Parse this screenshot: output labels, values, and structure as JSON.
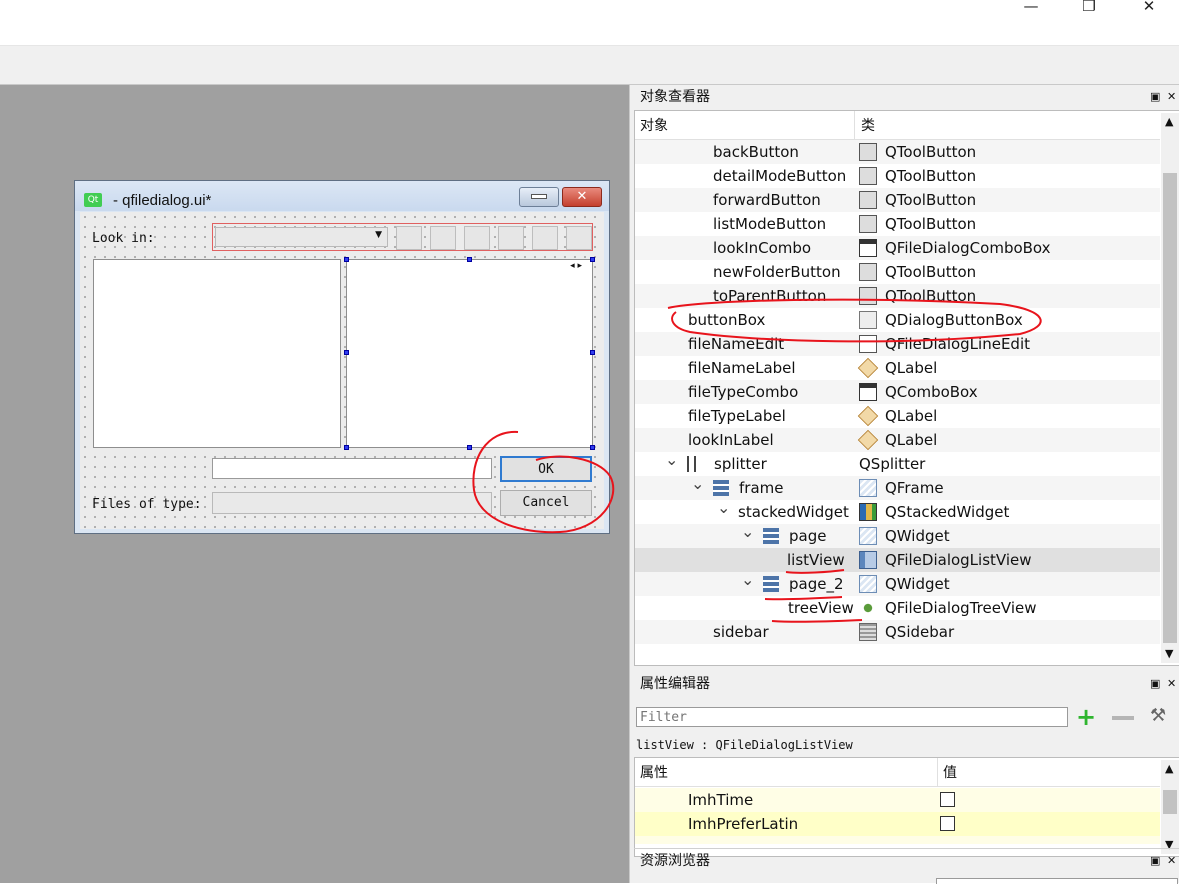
{
  "window": {
    "minimize": "—",
    "maximize": "❐",
    "close": "✕"
  },
  "form": {
    "title": "- qfiledialog.ui*",
    "logo": "Qt",
    "look_in_label": "Look in:",
    "files_of_type_label": "Files of type:",
    "ok_label": "OK",
    "cancel_label": "Cancel",
    "nav_arrows": "◂ ▸"
  },
  "object_inspector": {
    "title": "对象查看器",
    "col_object": "对象",
    "col_class": "类",
    "rows": [
      {
        "name": "backButton",
        "cls": "QToolButton",
        "icon": "tool-button-icon"
      },
      {
        "name": "detailModeButton",
        "cls": "QToolButton",
        "icon": "tool-button-icon"
      },
      {
        "name": "forwardButton",
        "cls": "QToolButton",
        "icon": "tool-button-icon"
      },
      {
        "name": "listModeButton",
        "cls": "QToolButton",
        "icon": "tool-button-icon"
      },
      {
        "name": "lookInCombo",
        "cls": "QFileDialogComboBox",
        "icon": "combo-box-icon"
      },
      {
        "name": "newFolderButton",
        "cls": "QToolButton",
        "icon": "tool-button-icon"
      },
      {
        "name": "toParentButton",
        "cls": "QToolButton",
        "icon": "tool-button-icon"
      },
      {
        "name": "buttonBox",
        "cls": "QDialogButtonBox",
        "icon": "dialog-button-box-icon"
      },
      {
        "name": "fileNameEdit",
        "cls": "QFileDialogLineEdit",
        "icon": "line-edit-icon"
      },
      {
        "name": "fileNameLabel",
        "cls": "QLabel",
        "icon": "label-icon"
      },
      {
        "name": "fileTypeCombo",
        "cls": "QComboBox",
        "icon": "combo-box-icon"
      },
      {
        "name": "fileTypeLabel",
        "cls": "QLabel",
        "icon": "label-icon"
      },
      {
        "name": "lookInLabel",
        "cls": "QLabel",
        "icon": "label-icon"
      },
      {
        "name": "splitter",
        "cls": "QSplitter",
        "icon": "splitter-icon"
      },
      {
        "name": "frame",
        "cls": "QFrame",
        "icon": "frame-icon"
      },
      {
        "name": "stackedWidget",
        "cls": "QStackedWidget",
        "icon": "stacked-widget-icon"
      },
      {
        "name": "page",
        "cls": "QWidget",
        "icon": "widget-icon"
      },
      {
        "name": "listView",
        "cls": "QFileDialogListView",
        "icon": "list-view-icon"
      },
      {
        "name": "page_2",
        "cls": "QWidget",
        "icon": "widget-icon"
      },
      {
        "name": "treeView",
        "cls": "QFileDialogTreeView",
        "icon": "tree-view-icon"
      },
      {
        "name": "sidebar",
        "cls": "QSidebar",
        "icon": "sidebar-icon"
      }
    ]
  },
  "property_editor": {
    "title": "属性编辑器",
    "filter_placeholder": "Filter",
    "current_object": "listView : QFileDialogListView",
    "col_property": "属性",
    "col_value": "值",
    "rows": [
      {
        "name": "ImhTime",
        "checked": false
      },
      {
        "name": "ImhPreferLatin",
        "checked": false
      }
    ]
  },
  "resource_browser": {
    "title": "资源浏览器"
  },
  "colors": {
    "annotation": "#e8141c",
    "selection_handle": "#2f3df0",
    "form_border": "#e06060"
  }
}
